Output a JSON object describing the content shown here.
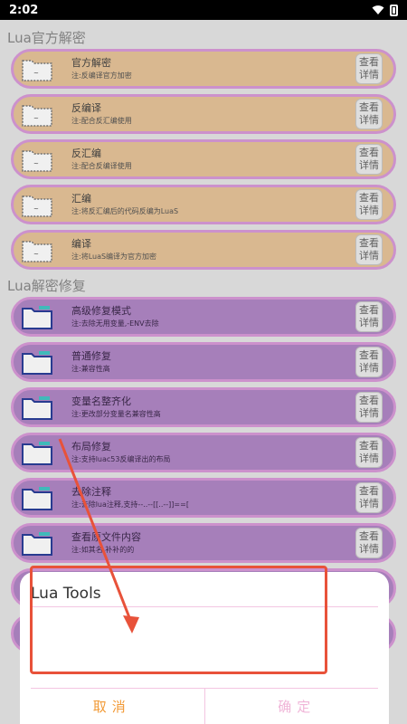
{
  "status": {
    "time": "2:02"
  },
  "sections": [
    {
      "title": "Lua官方解密",
      "items": [
        {
          "title": "官方解密",
          "desc": "注:反编译官方加密",
          "detail": [
            "查看",
            "详情"
          ]
        },
        {
          "title": "反编译",
          "desc": "注:配合反汇编使用",
          "detail": [
            "查看",
            "详情"
          ]
        },
        {
          "title": "反汇编",
          "desc": "注:配合反编译使用",
          "detail": [
            "查看",
            "详情"
          ]
        },
        {
          "title": "汇编",
          "desc": "注:将反汇编后的代码反编为LuaS",
          "detail": [
            "查看",
            "详情"
          ]
        },
        {
          "title": "编译",
          "desc": "注:将LuaS编译为官方加密",
          "detail": [
            "查看",
            "详情"
          ]
        }
      ]
    },
    {
      "title": "Lua解密修复",
      "items": [
        {
          "title": "高级修复模式",
          "desc": "注:去除无用变量,-ENV去除",
          "detail": [
            "查看",
            "详情"
          ]
        },
        {
          "title": "普通修复",
          "desc": "注:兼容性高",
          "detail": [
            "查看",
            "详情"
          ]
        },
        {
          "title": "变量名整齐化",
          "desc": "注:更改部分变量名兼容性高",
          "detail": [
            "查看",
            "详情"
          ]
        },
        {
          "title": "布局修复",
          "desc": "注:支持luac53反编译出的布局",
          "detail": [
            "查看",
            "详情"
          ]
        },
        {
          "title": "去除注释",
          "desc": "注:去除lua注释,支持--..--[[..--]]==[",
          "detail": [
            "查看",
            "详情"
          ]
        },
        {
          "title": "查看原文件内容",
          "desc": "注:如其名,补补的的",
          "detail": [
            "查看",
            "详情"
          ]
        }
      ]
    }
  ],
  "dialog": {
    "title": "Lua Tools",
    "cancel_label": "取消",
    "ok_label": "确定"
  },
  "colors": {
    "accent_orange": "#f29a36",
    "ok_pink": "#f0b5d8",
    "annotation_red": "#e8523a",
    "item_orange": "#e7c499",
    "item_purple": "#b187c6"
  }
}
